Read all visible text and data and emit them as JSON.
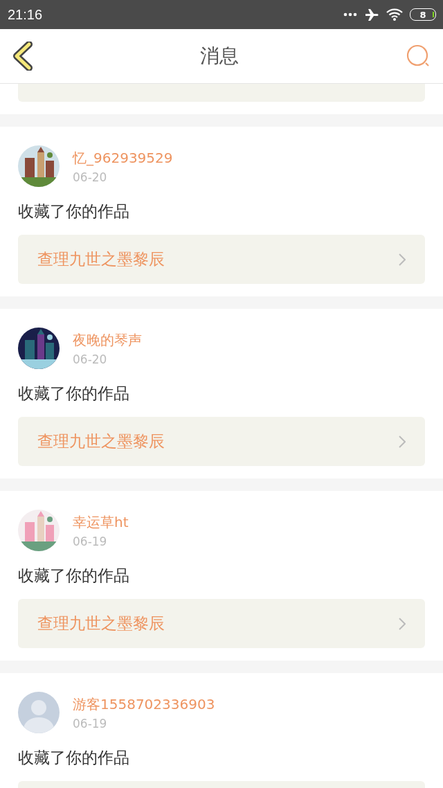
{
  "status_bar": {
    "time": "21:16",
    "battery": "8"
  },
  "header": {
    "title": "消息"
  },
  "messages": [
    {
      "user": "忆_962939529",
      "date": "06-20",
      "action": "收藏了你的作品",
      "work": "查理九世之墨黎辰"
    },
    {
      "user": "夜晚的琴声",
      "date": "06-20",
      "action": "收藏了你的作品",
      "work": "查理九世之墨黎辰"
    },
    {
      "user": "幸运草ht",
      "date": "06-19",
      "action": "收藏了你的作品",
      "work": "查理九世之墨黎辰"
    },
    {
      "user": "游客1558702336903",
      "date": "06-19",
      "avatar": {
        "kind": "default"
      },
      "action": "收藏了你的作品"
    }
  ]
}
